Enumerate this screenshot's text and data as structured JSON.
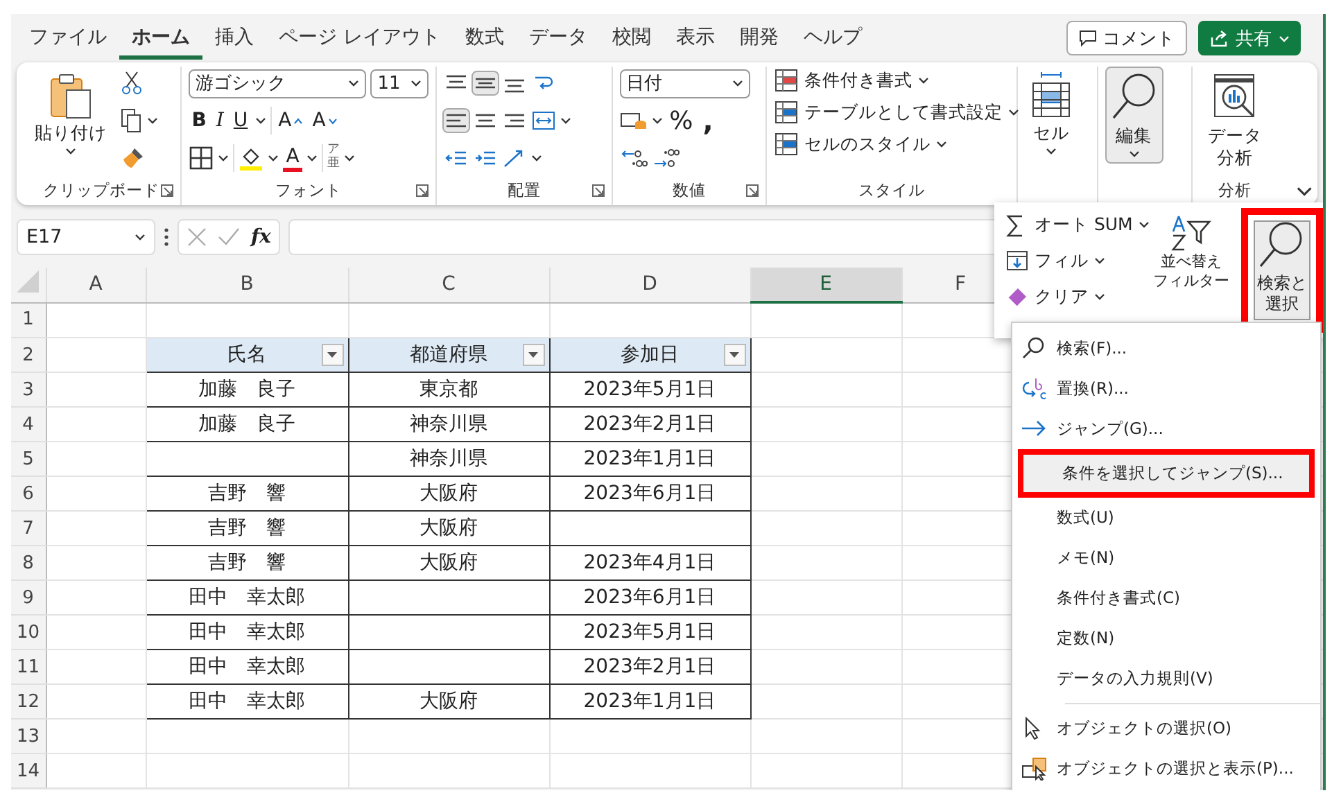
{
  "tabs": [
    {
      "label": "ファイル",
      "selected": false
    },
    {
      "label": "ホーム",
      "selected": true
    },
    {
      "label": "挿入",
      "selected": false
    },
    {
      "label": "ページ レイアウト",
      "selected": false
    },
    {
      "label": "数式",
      "selected": false
    },
    {
      "label": "データ",
      "selected": false
    },
    {
      "label": "校閲",
      "selected": false
    },
    {
      "label": "表示",
      "selected": false
    },
    {
      "label": "開発",
      "selected": false
    },
    {
      "label": "ヘルプ",
      "selected": false
    }
  ],
  "comment_button": "コメント",
  "share_button": "共有",
  "ribbon": {
    "clipboard": {
      "paste": "貼り付け",
      "label": "クリップボード"
    },
    "font": {
      "name": "游ゴシック",
      "size": "11",
      "bold": "B",
      "italic": "I",
      "underline": "U",
      "grow": "A",
      "shrink": "A",
      "font_color": "A",
      "furigana": "ア亜",
      "label": "フォント"
    },
    "alignment": {
      "label": "配置"
    },
    "number": {
      "format": "日付",
      "percent": "%",
      "comma": ",",
      "label": "数値"
    },
    "styles": {
      "items": [
        "条件付き書式",
        "テーブルとして書式設定",
        "セルのスタイル"
      ],
      "label": "スタイル"
    },
    "cells": {
      "label": "セル"
    },
    "editing": {
      "label": "編集",
      "selected": true
    },
    "analysis": {
      "button": "データ分析",
      "label": "分析"
    }
  },
  "formula_bar": {
    "name_box": "E17",
    "function_button": "fx"
  },
  "sheet": {
    "columns": [
      {
        "label": "A",
        "selected": false
      },
      {
        "label": "B",
        "selected": false
      },
      {
        "label": "C",
        "selected": false
      },
      {
        "label": "D",
        "selected": false
      },
      {
        "label": "E",
        "selected": true
      },
      {
        "label": "F",
        "selected": false
      }
    ],
    "row_numbers": [
      "1",
      "2",
      "3",
      "4",
      "5",
      "6",
      "7",
      "8",
      "9",
      "10",
      "11",
      "12",
      "13",
      "14"
    ],
    "table": {
      "headers": [
        "氏名",
        "都道府県",
        "参加日"
      ],
      "rows": [
        [
          "加藤　良子",
          "東京都",
          "2023年5月1日"
        ],
        [
          "加藤　良子",
          "神奈川県",
          "2023年2月1日"
        ],
        [
          "",
          "神奈川県",
          "2023年1月1日"
        ],
        [
          "吉野　響",
          "大阪府",
          "2023年6月1日"
        ],
        [
          "吉野　響",
          "大阪府",
          ""
        ],
        [
          "吉野　響",
          "大阪府",
          "2023年4月1日"
        ],
        [
          "田中　幸太郎",
          "",
          "2023年6月1日"
        ],
        [
          "田中　幸太郎",
          "",
          "2023年5月1日"
        ],
        [
          "田中　幸太郎",
          "",
          "2023年2月1日"
        ],
        [
          "田中　幸太郎",
          "大阪府",
          "2023年1月1日"
        ]
      ]
    }
  },
  "editing_panel": {
    "items": [
      {
        "label": "オート SUM",
        "kind": "autosum"
      },
      {
        "label": "フィル",
        "kind": "fill"
      },
      {
        "label": "クリア",
        "kind": "clear"
      }
    ],
    "sort_filter": [
      "並べ替え",
      "フィルター"
    ],
    "find_select": {
      "label": "検索と選択",
      "selected": true,
      "highlighted": true
    }
  },
  "find_menu": {
    "items": [
      {
        "label": "検索(F)...",
        "kind": "search",
        "hovered": false,
        "highlighted": false
      },
      {
        "label": "置換(R)...",
        "kind": "replace",
        "hovered": false,
        "highlighted": false
      },
      {
        "label": "ジャンプ(G)...",
        "kind": "goto",
        "hovered": false,
        "highlighted": false
      },
      {
        "label": "条件を選択してジャンプ(S)...",
        "kind": "plain",
        "hovered": true,
        "highlighted": true
      },
      {
        "label": "数式(U)",
        "kind": "plain",
        "hovered": false,
        "highlighted": false
      },
      {
        "label": "メモ(N)",
        "kind": "plain",
        "hovered": false,
        "highlighted": false
      },
      {
        "label": "条件付き書式(C)",
        "kind": "plain",
        "hovered": false,
        "highlighted": false
      },
      {
        "label": "定数(N)",
        "kind": "plain",
        "hovered": false,
        "highlighted": false
      },
      {
        "label": "データの入力規則(V)",
        "kind": "plain",
        "hovered": false,
        "highlighted": false
      },
      {
        "kind": "separator"
      },
      {
        "label": "オブジェクトの選択(O)",
        "kind": "pointer",
        "hovered": false,
        "highlighted": false
      },
      {
        "label": "オブジェクトの選択と表示(P)...",
        "kind": "pane",
        "hovered": false,
        "highlighted": false
      }
    ]
  }
}
